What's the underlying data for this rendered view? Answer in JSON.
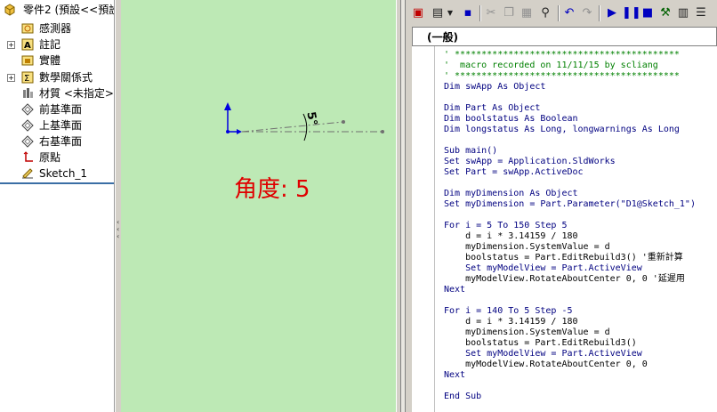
{
  "feature_tree": {
    "root_label": "零件2 (預設<<預設",
    "items": [
      {
        "label": "感測器",
        "icon": "sensor-icon"
      },
      {
        "label": "註記",
        "icon": "annotations-icon"
      },
      {
        "label": "實體",
        "icon": "solid-body-icon"
      },
      {
        "label": "數學關係式",
        "icon": "equations-icon"
      },
      {
        "label": "材質 <未指定>",
        "icon": "material-icon"
      },
      {
        "label": "前基準面",
        "icon": "plane-icon"
      },
      {
        "label": "上基準面",
        "icon": "plane-icon"
      },
      {
        "label": "右基準面",
        "icon": "plane-icon"
      },
      {
        "label": "原點",
        "icon": "origin-icon"
      },
      {
        "label": "Sketch_1",
        "icon": "sketch-icon"
      }
    ]
  },
  "viewport": {
    "angle_text": "角度: 5",
    "dimension_label": "5°",
    "background": "#bde9b5",
    "angle_color": "#e00000"
  },
  "vba_editor": {
    "procedure_combo": "(一般)",
    "code_lines": [
      {
        "text": "' ******************************************",
        "c": "cm"
      },
      {
        "text": "'  macro recorded on 11/11/15 by scliang",
        "c": "cm"
      },
      {
        "text": "' ******************************************",
        "c": "cm"
      },
      {
        "text": "Dim swApp As Object",
        "c": "kw"
      },
      {
        "text": "",
        "c": ""
      },
      {
        "text": "Dim Part As Object",
        "c": "kw"
      },
      {
        "text": "Dim boolstatus As Boolean",
        "c": "kw"
      },
      {
        "text": "Dim longstatus As Long, longwarnings As Long",
        "c": "kw"
      },
      {
        "text": "",
        "c": ""
      },
      {
        "text": "Sub main()",
        "c": "kw"
      },
      {
        "text": "Set swApp = Application.SldWorks",
        "c": "kw"
      },
      {
        "text": "Set Part = swApp.ActiveDoc",
        "c": "kw"
      },
      {
        "text": "",
        "c": ""
      },
      {
        "text": "Dim myDimension As Object",
        "c": "kw"
      },
      {
        "text": "Set myDimension = Part.Parameter(\"D1@Sketch_1\")",
        "c": "kw"
      },
      {
        "text": "",
        "c": ""
      },
      {
        "text": "For i = 5 To 150 Step 5",
        "c": "kw"
      },
      {
        "text": "    d = i * 3.14159 / 180",
        "c": ""
      },
      {
        "text": "    myDimension.SystemValue = d",
        "c": ""
      },
      {
        "text": "    boolstatus = Part.EditRebuild3() '重新計算",
        "c": ""
      },
      {
        "text": "    Set myModelView = Part.ActiveView",
        "c": "kw"
      },
      {
        "text": "    myModelView.RotateAboutCenter 0, 0 '延遲用",
        "c": ""
      },
      {
        "text": "Next",
        "c": "kw"
      },
      {
        "text": "",
        "c": ""
      },
      {
        "text": "For i = 140 To 5 Step -5",
        "c": "kw"
      },
      {
        "text": "    d = i * 3.14159 / 180",
        "c": ""
      },
      {
        "text": "    myDimension.SystemValue = d",
        "c": ""
      },
      {
        "text": "    boolstatus = Part.EditRebuild3()",
        "c": ""
      },
      {
        "text": "    Set myModelView = Part.ActiveView",
        "c": "kw"
      },
      {
        "text": "    myModelView.RotateAboutCenter 0, 0",
        "c": ""
      },
      {
        "text": "Next",
        "c": "kw"
      },
      {
        "text": "",
        "c": ""
      },
      {
        "text": "End Sub",
        "c": "kw"
      }
    ]
  },
  "colors": {
    "keyword": "#000080",
    "comment": "#008000",
    "accent": "#3a6ea5"
  }
}
